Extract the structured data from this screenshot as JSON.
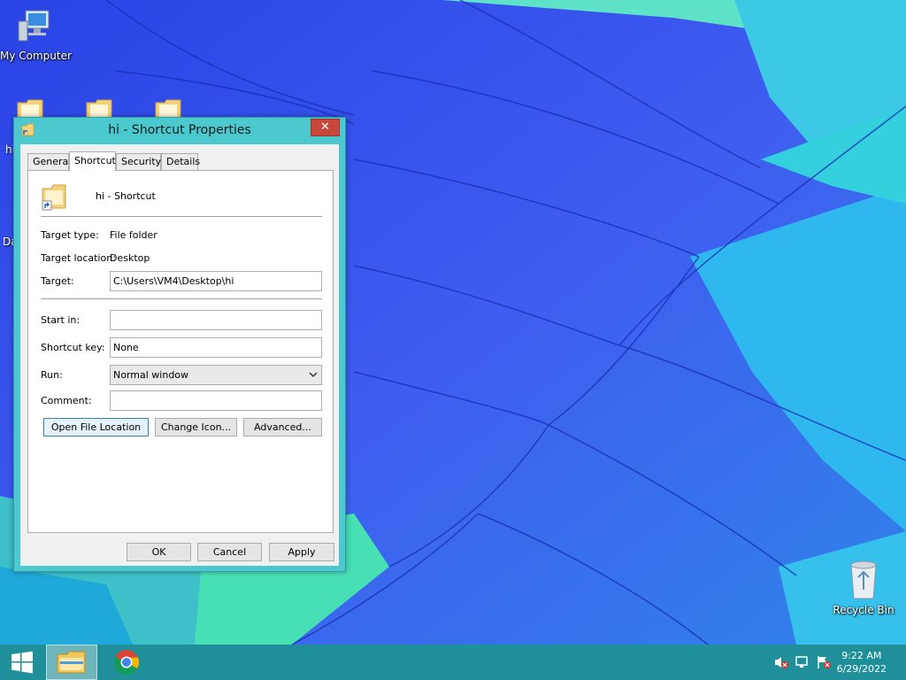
{
  "desktop": {
    "icons": {
      "my_computer": "My Computer",
      "hi_partial": "hi",
      "da_partial": "Da",
      "recycle_bin": "Recycle Bin"
    }
  },
  "dialog": {
    "title": "hi - Shortcut Properties",
    "close_label": "✕",
    "tabs": [
      {
        "label": "General"
      },
      {
        "label": "Shortcut"
      },
      {
        "label": "Security"
      },
      {
        "label": "Details"
      }
    ],
    "active_tab": "Shortcut",
    "shortcut_name": "hi - Shortcut",
    "target_type_label": "Target type:",
    "target_type_value": "File folder",
    "target_location_label": "Target location:",
    "target_location_value": "Desktop",
    "target_label": "Target:",
    "target_value": "C:\\Users\\VM4\\Desktop\\hi",
    "start_in_label": "Start in:",
    "start_in_value": "",
    "shortcut_key_label": "Shortcut key:",
    "shortcut_key_value": "None",
    "run_label": "Run:",
    "run_value": "Normal window",
    "comment_label": "Comment:",
    "comment_value": "",
    "buttons": {
      "open_file_location": "Open File Location",
      "change_icon": "Change Icon...",
      "advanced": "Advanced...",
      "ok": "OK",
      "cancel": "Cancel",
      "apply": "Apply"
    }
  },
  "taskbar": {
    "clock_time": "9:22 AM",
    "clock_date": "6/29/2022",
    "items": [
      "start-icon",
      "file-explorer-icon",
      "chrome-icon"
    ],
    "tray": [
      "volume-muted-icon",
      "network-icon",
      "action-center-flag-icon"
    ]
  }
}
